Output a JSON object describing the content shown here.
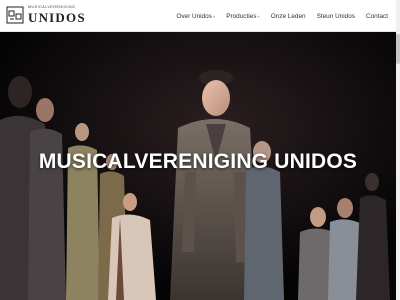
{
  "header": {
    "logo": {
      "tagline": "Musicalvereniging",
      "name": "UNIDOS"
    },
    "nav": [
      {
        "label": "Over Unidos",
        "has_dropdown": true
      },
      {
        "label": "Producties",
        "has_dropdown": true
      },
      {
        "label": "Onze Leden",
        "has_dropdown": false
      },
      {
        "label": "Steun Unidos",
        "has_dropdown": false
      },
      {
        "label": "Contact",
        "has_dropdown": false
      }
    ],
    "chevron": "˅"
  },
  "hero": {
    "title": "MUSICALVERENIGING UNIDOS",
    "image": "stage-performance-photo"
  },
  "colors": {
    "header_bg": "#ffffff",
    "nav_text": "#333333",
    "hero_text": "#ffffff"
  }
}
